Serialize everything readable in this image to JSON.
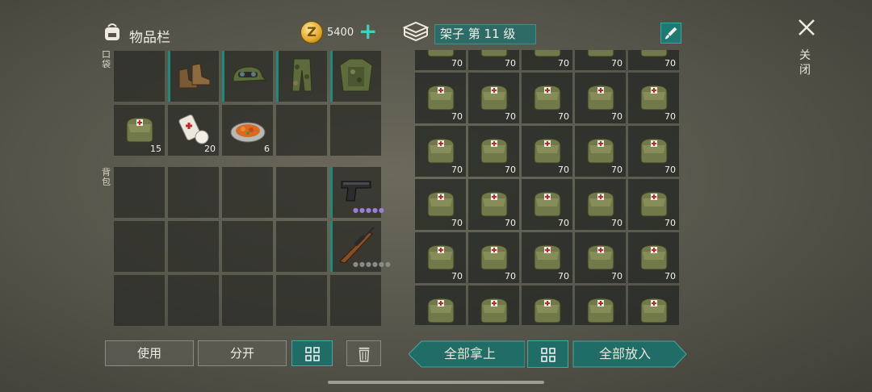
{
  "inventory": {
    "title": "物品栏",
    "pockets_label": "口袋",
    "backpack_label": "背包",
    "coins": "5400",
    "coin_symbol": "Z"
  },
  "shelf": {
    "title": "架子 第 11 级",
    "item_count": "70"
  },
  "close": {
    "label": "关闭"
  },
  "pocket_slots": [
    {
      "item": "boots",
      "equipped": true,
      "count": ""
    },
    {
      "item": "cap-with-goggles",
      "equipped": true,
      "count": ""
    },
    {
      "item": "camo-pants",
      "equipped": true,
      "count": ""
    },
    {
      "item": "camo-jacket",
      "equipped": true,
      "count": ""
    },
    {
      "item": "first-aid-bag",
      "count": "15"
    },
    {
      "item": "bandage",
      "count": "20"
    },
    {
      "item": "food-plate",
      "count": "6"
    },
    {
      "item": "",
      "count": ""
    },
    {
      "item": "",
      "count": ""
    }
  ],
  "backpack_weapons": [
    {
      "item": "pistol",
      "rarity": "●●●●●"
    },
    {
      "item": "sniper-rifle",
      "rarity": "●●●●●●"
    }
  ],
  "buttons": {
    "use": "使用",
    "split": "分开",
    "take_all": "全部拿上",
    "put_all": "全部放入"
  },
  "colors": {
    "accent": "#1f6d66",
    "marker": "#1d8a7e"
  }
}
